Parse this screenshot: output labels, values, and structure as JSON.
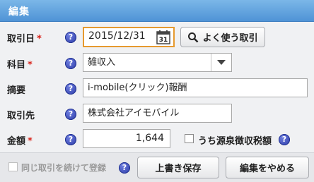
{
  "title": "編集",
  "required_mark": "*",
  "help_glyph": "?",
  "rows": {
    "date": {
      "label": "取引日",
      "required": true,
      "value": "2015/12/31"
    },
    "subject": {
      "label": "科目",
      "required": true,
      "value": "雑収入"
    },
    "summary": {
      "label": "摘要",
      "required": false,
      "value": "i-mobile(クリック)報酬"
    },
    "partner": {
      "label": "取引先",
      "required": false,
      "value": "株式会社アイモバイル"
    },
    "amount": {
      "label": "金額",
      "required": true,
      "value": "1,644"
    }
  },
  "buttons": {
    "frequent": "よく使う取引",
    "overwrite_save": "上書き保存",
    "cancel_edit": "編集をやめる"
  },
  "withholding_checkbox_label": "うち源泉徴収税額",
  "continue_checkbox_label": "同じ取引を続けて登録",
  "calendar_day": "31",
  "colors": {
    "title_bar": "#5a9de0",
    "required": "#d9251c",
    "focus_border": "#e69a2f",
    "help_icon": "#2b3aa6"
  }
}
